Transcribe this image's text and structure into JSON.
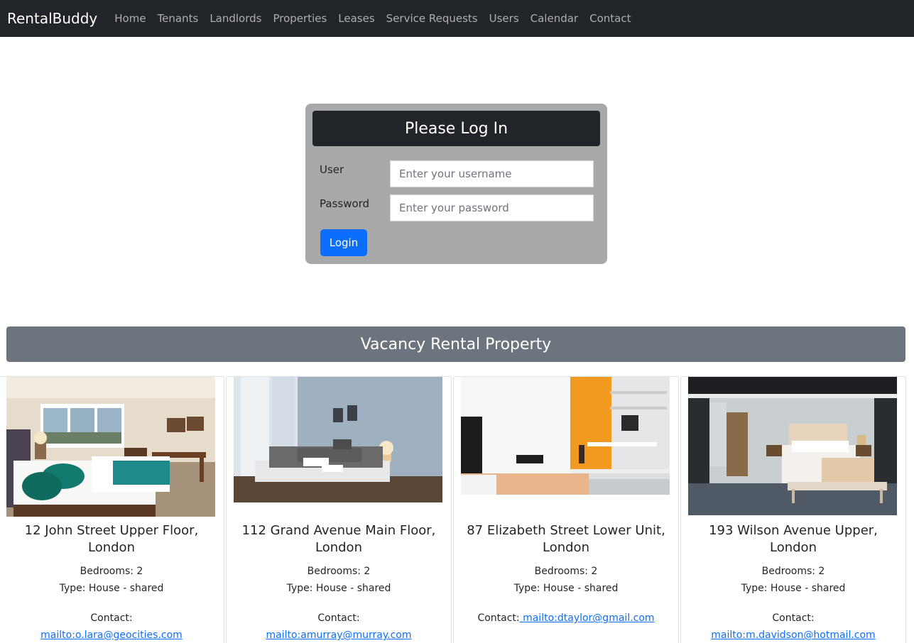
{
  "navbar": {
    "brand": "RentalBuddy",
    "links": [
      "Home",
      "Tenants",
      "Landlords",
      "Properties",
      "Leases",
      "Service Requests",
      "Users",
      "Calendar",
      "Contact"
    ]
  },
  "login": {
    "title": "Please Log In",
    "user_label": "User",
    "user_placeholder": "Enter your username",
    "password_label": "Password",
    "password_placeholder": "Enter your password",
    "button_label": "Login"
  },
  "vacancy": {
    "title": "Vacancy Rental Property",
    "properties": [
      {
        "address": "12 John Street Upper Floor, London",
        "bedrooms": "Bedrooms: 2",
        "type": "Type: House - shared",
        "contact_label": "Contact:",
        "contact_link": "mailto:o.lara@geocities.com"
      },
      {
        "address": "112 Grand Avenue Main Floor, London",
        "bedrooms": "Bedrooms: 2",
        "type": "Type: House - shared",
        "contact_label": "Contact:",
        "contact_link": "mailto:amurray@murray.com"
      },
      {
        "address": "87 Elizabeth Street Lower Unit, London",
        "bedrooms": "Bedrooms: 2",
        "type": "Type: House - shared",
        "contact_label": "Contact:",
        "contact_link": " mailto:dtaylor@gmail.com"
      },
      {
        "address": "193 Wilson Avenue Upper, London",
        "bedrooms": "Bedrooms: 2",
        "type": "Type: House - shared",
        "contact_label": "Contact:",
        "contact_link": "mailto:m.davidson@hotmail.com"
      }
    ]
  },
  "colors": {
    "navbar_bg": "#212529",
    "login_panel_bg": "#a9a9a9",
    "vacancy_bar_bg": "#6c757d",
    "primary": "#0d6efd"
  }
}
